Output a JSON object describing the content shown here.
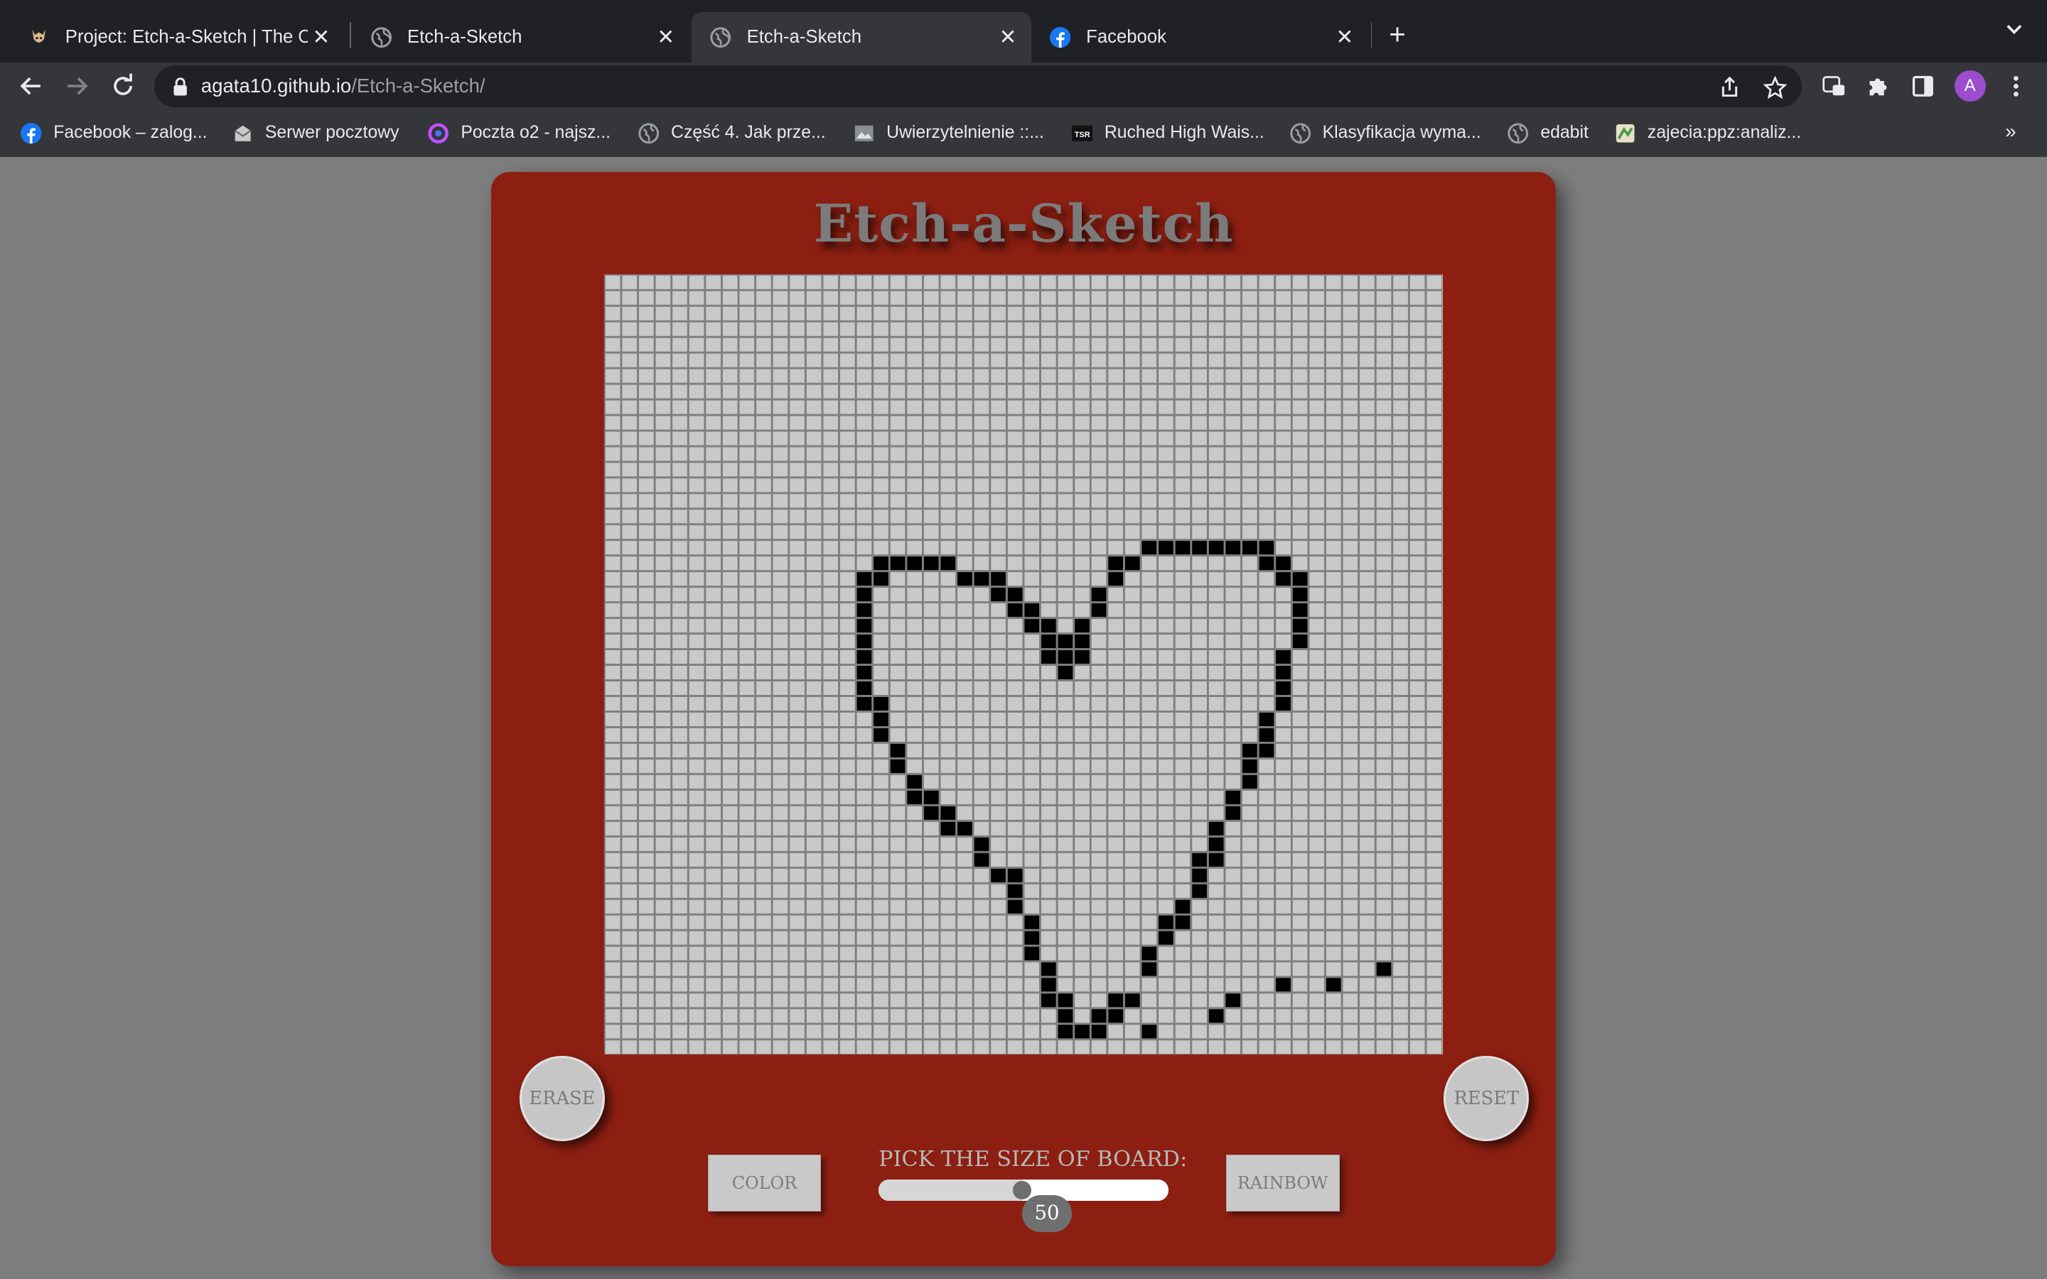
{
  "browser": {
    "tabs": [
      {
        "title": "Project: Etch-a-Sketch | The Od",
        "icon": "odin-project-icon",
        "active": false
      },
      {
        "title": "Etch-a-Sketch",
        "icon": "globe-icon",
        "active": false
      },
      {
        "title": "Etch-a-Sketch",
        "icon": "globe-icon",
        "active": true
      },
      {
        "title": "Facebook",
        "icon": "facebook-icon",
        "active": false
      }
    ],
    "url_host": "agata10.github.io",
    "url_path": "/Etch-a-Sketch/",
    "avatar_letter": "A",
    "avatar_color": "#9c4ccc",
    "bookmarks": [
      {
        "label": "Facebook – zalog...",
        "icon": "facebook-icon"
      },
      {
        "label": "Serwer pocztowy",
        "icon": "mail-icon"
      },
      {
        "label": "Poczta o2 - najsz...",
        "icon": "o2-icon"
      },
      {
        "label": "Część 4. Jak prze...",
        "icon": "globe-icon"
      },
      {
        "label": "Uwierzytelnienie ::...",
        "icon": "image-icon"
      },
      {
        "label": "Ruched High Wais...",
        "icon": "tsr-icon"
      },
      {
        "label": "Klasyfikacja wyma...",
        "icon": "globe-icon"
      },
      {
        "label": "edabit",
        "icon": "globe-icon"
      },
      {
        "label": "zajecia:ppz:analiz...",
        "icon": "wiki-icon"
      }
    ]
  },
  "app": {
    "title": "Etch-a-Sketch",
    "erase_label": "ERASE",
    "reset_label": "RESET",
    "color_label": "COLOR",
    "rainbow_label": "RAINBOW",
    "size_label": "PICK THE SIZE OF BOARD:",
    "board_size": 50,
    "board_size_display": "50",
    "slider_min": 1,
    "slider_max": 100,
    "frame_color": "#8c1f12",
    "filled_color": "#000000",
    "cell_color": "#c9c9c9",
    "filled_cells": [
      [
        16,
        18
      ],
      [
        17,
        18
      ],
      [
        18,
        18
      ],
      [
        19,
        18
      ],
      [
        20,
        18
      ],
      [
        32,
        17
      ],
      [
        33,
        17
      ],
      [
        34,
        17
      ],
      [
        35,
        17
      ],
      [
        36,
        17
      ],
      [
        37,
        17
      ],
      [
        38,
        17
      ],
      [
        39,
        17
      ],
      [
        30,
        18
      ],
      [
        31,
        18
      ],
      [
        39,
        18
      ],
      [
        40,
        18
      ],
      [
        15,
        19
      ],
      [
        16,
        19
      ],
      [
        21,
        19
      ],
      [
        22,
        19
      ],
      [
        23,
        19
      ],
      [
        30,
        19
      ],
      [
        40,
        19
      ],
      [
        41,
        19
      ],
      [
        15,
        20
      ],
      [
        23,
        20
      ],
      [
        24,
        20
      ],
      [
        29,
        20
      ],
      [
        41,
        20
      ],
      [
        15,
        21
      ],
      [
        24,
        21
      ],
      [
        25,
        21
      ],
      [
        29,
        21
      ],
      [
        41,
        21
      ],
      [
        15,
        22
      ],
      [
        25,
        22
      ],
      [
        26,
        22
      ],
      [
        28,
        22
      ],
      [
        41,
        22
      ],
      [
        15,
        23
      ],
      [
        26,
        23
      ],
      [
        27,
        23
      ],
      [
        28,
        23
      ],
      [
        41,
        23
      ],
      [
        15,
        24
      ],
      [
        26,
        24
      ],
      [
        27,
        24
      ],
      [
        28,
        24
      ],
      [
        40,
        24
      ],
      [
        15,
        25
      ],
      [
        27,
        25
      ],
      [
        40,
        25
      ],
      [
        15,
        26
      ],
      [
        40,
        26
      ],
      [
        15,
        27
      ],
      [
        16,
        27
      ],
      [
        40,
        27
      ],
      [
        16,
        28
      ],
      [
        39,
        28
      ],
      [
        16,
        29
      ],
      [
        39,
        29
      ],
      [
        17,
        30
      ],
      [
        38,
        30
      ],
      [
        39,
        30
      ],
      [
        17,
        31
      ],
      [
        38,
        31
      ],
      [
        18,
        32
      ],
      [
        38,
        32
      ],
      [
        18,
        33
      ],
      [
        19,
        33
      ],
      [
        37,
        33
      ],
      [
        19,
        34
      ],
      [
        20,
        34
      ],
      [
        37,
        34
      ],
      [
        20,
        35
      ],
      [
        21,
        35
      ],
      [
        36,
        35
      ],
      [
        22,
        36
      ],
      [
        36,
        36
      ],
      [
        22,
        37
      ],
      [
        35,
        37
      ],
      [
        36,
        37
      ],
      [
        23,
        38
      ],
      [
        24,
        38
      ],
      [
        35,
        38
      ],
      [
        24,
        39
      ],
      [
        35,
        39
      ],
      [
        24,
        40
      ],
      [
        34,
        40
      ],
      [
        25,
        41
      ],
      [
        33,
        41
      ],
      [
        34,
        41
      ],
      [
        25,
        42
      ],
      [
        33,
        42
      ],
      [
        25,
        43
      ],
      [
        32,
        43
      ],
      [
        26,
        44
      ],
      [
        32,
        44
      ],
      [
        46,
        44
      ],
      [
        26,
        45
      ],
      [
        40,
        45
      ],
      [
        43,
        45
      ],
      [
        26,
        46
      ],
      [
        27,
        46
      ],
      [
        30,
        46
      ],
      [
        31,
        46
      ],
      [
        37,
        46
      ],
      [
        27,
        47
      ],
      [
        29,
        47
      ],
      [
        30,
        47
      ],
      [
        36,
        47
      ],
      [
        27,
        48
      ],
      [
        28,
        48
      ],
      [
        29,
        48
      ],
      [
        32,
        48
      ]
    ]
  }
}
